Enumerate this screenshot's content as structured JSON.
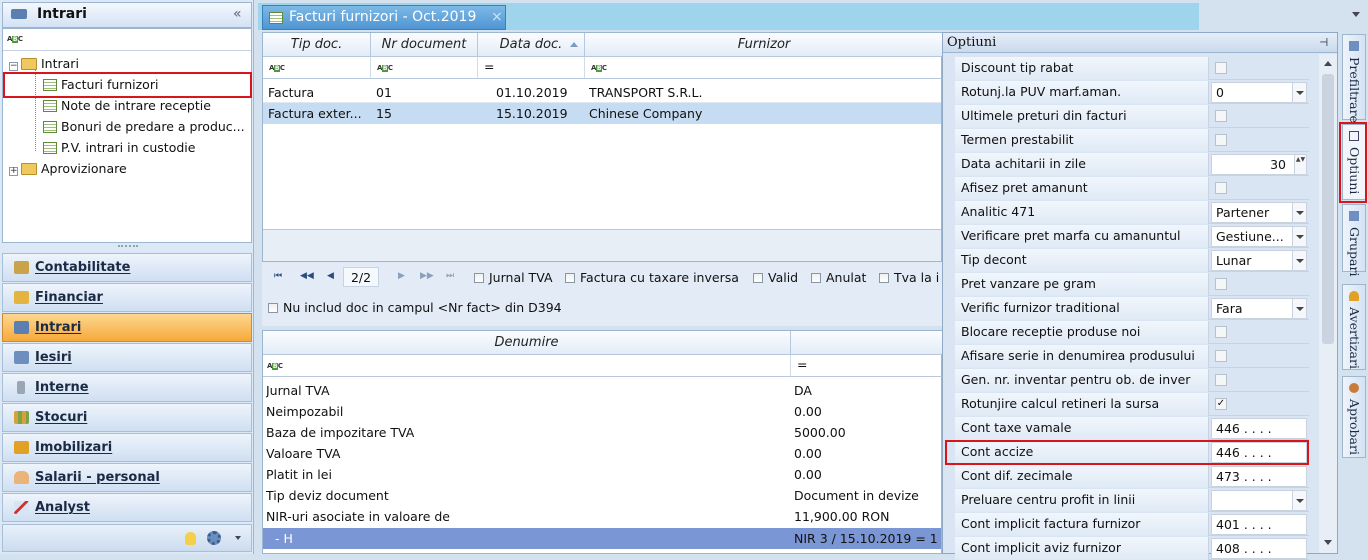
{
  "left": {
    "header": "Intrari",
    "collapse_icon": "«",
    "tree": [
      {
        "label": "Intrari"
      },
      {
        "label": "Facturi furnizori"
      },
      {
        "label": "Note de intrare receptie"
      },
      {
        "label": "Bonuri de predare a produc..."
      },
      {
        "label": "P.V. intrari in custodie"
      },
      {
        "label": "Aprovizionare"
      }
    ],
    "nav": [
      {
        "label": "Contabilitate"
      },
      {
        "label": "Financiar"
      },
      {
        "label": "Intrari"
      },
      {
        "label": "Iesiri"
      },
      {
        "label": "Interne"
      },
      {
        "label": "Stocuri"
      },
      {
        "label": "Imobilizari"
      },
      {
        "label": "Salarii - personal"
      },
      {
        "label": "Analyst"
      }
    ]
  },
  "tab": {
    "title": "Facturi furnizori - Oct.2019",
    "close": "×"
  },
  "grid": {
    "columns": [
      "Tip doc.",
      "Nr document",
      "Data doc.",
      "Furnizor"
    ],
    "filter_eq": "=",
    "rows": [
      [
        "Factura",
        "01",
        "01.10.2019",
        "TRANSPORT S.R.L."
      ],
      [
        "Factura exter...",
        "15",
        "15.10.2019",
        "Chinese Company"
      ]
    ]
  },
  "pager": {
    "page": "2/2",
    "checks": [
      "Jurnal TVA",
      "Factura cu taxare inversa",
      "Valid",
      "Anulat",
      "Tva la i"
    ],
    "check2": "Nu includ doc in campul <Nr fact> din D394"
  },
  "detail": {
    "column": "Denumire",
    "filter_eq": "=",
    "rows": [
      [
        "Jurnal TVA",
        "DA"
      ],
      [
        "Neimpozabil",
        "0.00"
      ],
      [
        "Baza de impozitare TVA",
        "5000.00"
      ],
      [
        "Valoare TVA",
        "0.00"
      ],
      [
        "Platit in lei",
        "0.00"
      ],
      [
        "Tip deviz document",
        "Document in devize"
      ],
      [
        "NIR-uri asociate in valoare de",
        "11,900.00 RON"
      ],
      [
        "- H",
        "NIR 3 / 15.10.2019 = 1"
      ]
    ]
  },
  "options": {
    "title": "Optiuni",
    "pin": "⊣",
    "rows": [
      {
        "label": "Discount tip rabat",
        "value": "",
        "kind": "check"
      },
      {
        "label": "Rotunj.la PUV marf.aman.",
        "value": "0",
        "kind": "combo"
      },
      {
        "label": "Ultimele preturi din facturi",
        "value": "",
        "kind": "check"
      },
      {
        "label": "Termen prestabilit",
        "value": "",
        "kind": "check"
      },
      {
        "label": "Data achitarii in zile",
        "value": "30",
        "kind": "spin"
      },
      {
        "label": "Afisez pret amanunt",
        "value": "",
        "kind": "check"
      },
      {
        "label": "Analitic 471",
        "value": "Partener",
        "kind": "combo"
      },
      {
        "label": "Verificare pret marfa cu amanuntul",
        "value": "Gestiune...",
        "kind": "combo"
      },
      {
        "label": "Tip decont",
        "value": "Lunar",
        "kind": "combo"
      },
      {
        "label": "Pret vanzare pe gram",
        "value": "",
        "kind": "check"
      },
      {
        "label": "Verific furnizor traditional",
        "value": "Fara",
        "kind": "combo"
      },
      {
        "label": "Blocare receptie produse noi",
        "value": "",
        "kind": "check"
      },
      {
        "label": "Afisare serie in denumirea produsului",
        "value": "",
        "kind": "check"
      },
      {
        "label": "Gen. nr. inventar pentru ob. de inver",
        "value": "",
        "kind": "check"
      },
      {
        "label": "Rotunjire calcul retineri la sursa",
        "value": "✓",
        "kind": "check"
      },
      {
        "label": "Cont taxe vamale",
        "value": "446 . . . .",
        "kind": "text"
      },
      {
        "label": "Cont accize",
        "value": "446 . . . .",
        "kind": "text"
      },
      {
        "label": "Cont dif. zecimale",
        "value": "473 . . . .",
        "kind": "text"
      },
      {
        "label": "Preluare centru profit in linii",
        "value": "",
        "kind": "combo"
      },
      {
        "label": "Cont implicit factura furnizor",
        "value": "401 . . . .",
        "kind": "text"
      },
      {
        "label": "Cont implicit aviz furnizor",
        "value": "408 . . . .",
        "kind": "text"
      }
    ]
  },
  "side_tabs": [
    "Prefiltrare",
    "Optiuni",
    "Grupari",
    "Avertizari",
    "Aprobari"
  ],
  "colors": {
    "accent_orange": "#f7a93a",
    "selected_row": "#c6dcf2",
    "highlight_red": "#d9151b",
    "tab_blue": "#4f95d3"
  }
}
